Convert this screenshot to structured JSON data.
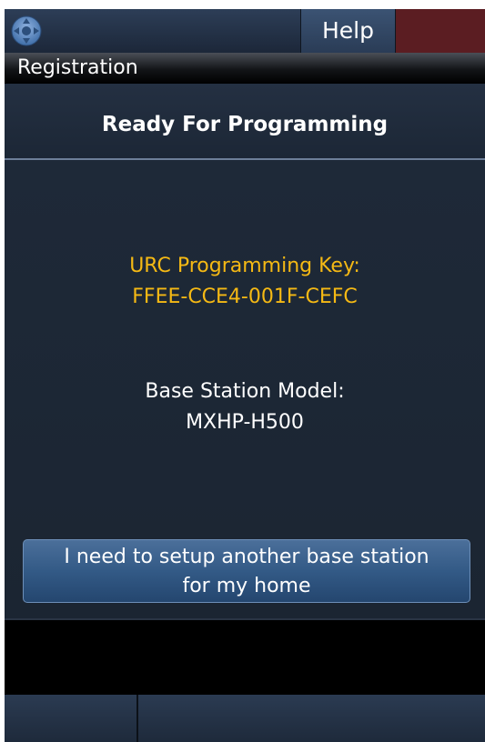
{
  "topbar": {
    "logo_icon": "remote-logo-icon",
    "help_label": "Help",
    "alert_color": "#5b1d22"
  },
  "section": {
    "title": "Registration"
  },
  "status": {
    "title": "Ready For Programming"
  },
  "programming_key": {
    "label": "URC Programming Key:",
    "value": "FFEE-CCE4-001F-CEFC",
    "color": "#f5b914"
  },
  "base_station": {
    "label": "Base Station Model:",
    "value": "MXHP-H500"
  },
  "setup_button": {
    "line1": "I need to setup another base station",
    "line2": "for my home"
  },
  "bottom_tabs": {
    "left_label": "",
    "right_label": ""
  }
}
